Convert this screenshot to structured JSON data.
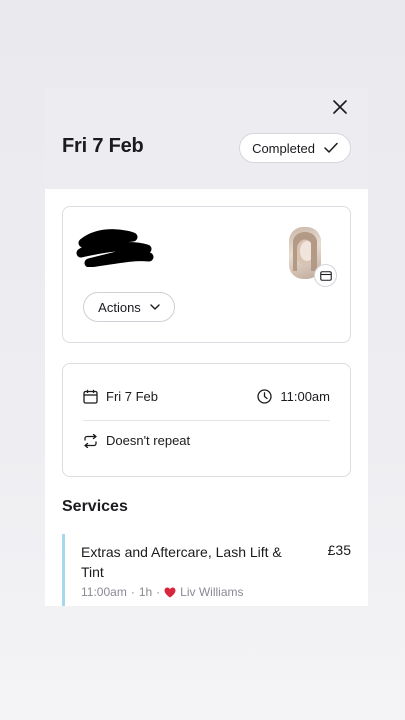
{
  "header": {
    "date_title": "Fri 7 Feb",
    "status_label": "Completed"
  },
  "client": {
    "actions_label": "Actions"
  },
  "schedule": {
    "date": "Fri 7 Feb",
    "time": "11:00am",
    "repeat": "Doesn't repeat"
  },
  "services": {
    "title": "Services",
    "items": [
      {
        "name": "Extras and Aftercare, Lash Lift & Tint",
        "price": "£35",
        "time": "11:00am",
        "duration": "1h",
        "staff": "Liv Williams"
      }
    ]
  },
  "colors": {
    "service_accent": "#a8d8f0",
    "heart": "#d7263d",
    "header_bg": "#ececf1"
  },
  "icons": [
    "close-icon",
    "checkmark-icon",
    "chevron-down-icon",
    "calendar-icon",
    "clock-icon",
    "repeat-icon",
    "card-icon",
    "heart-icon"
  ]
}
